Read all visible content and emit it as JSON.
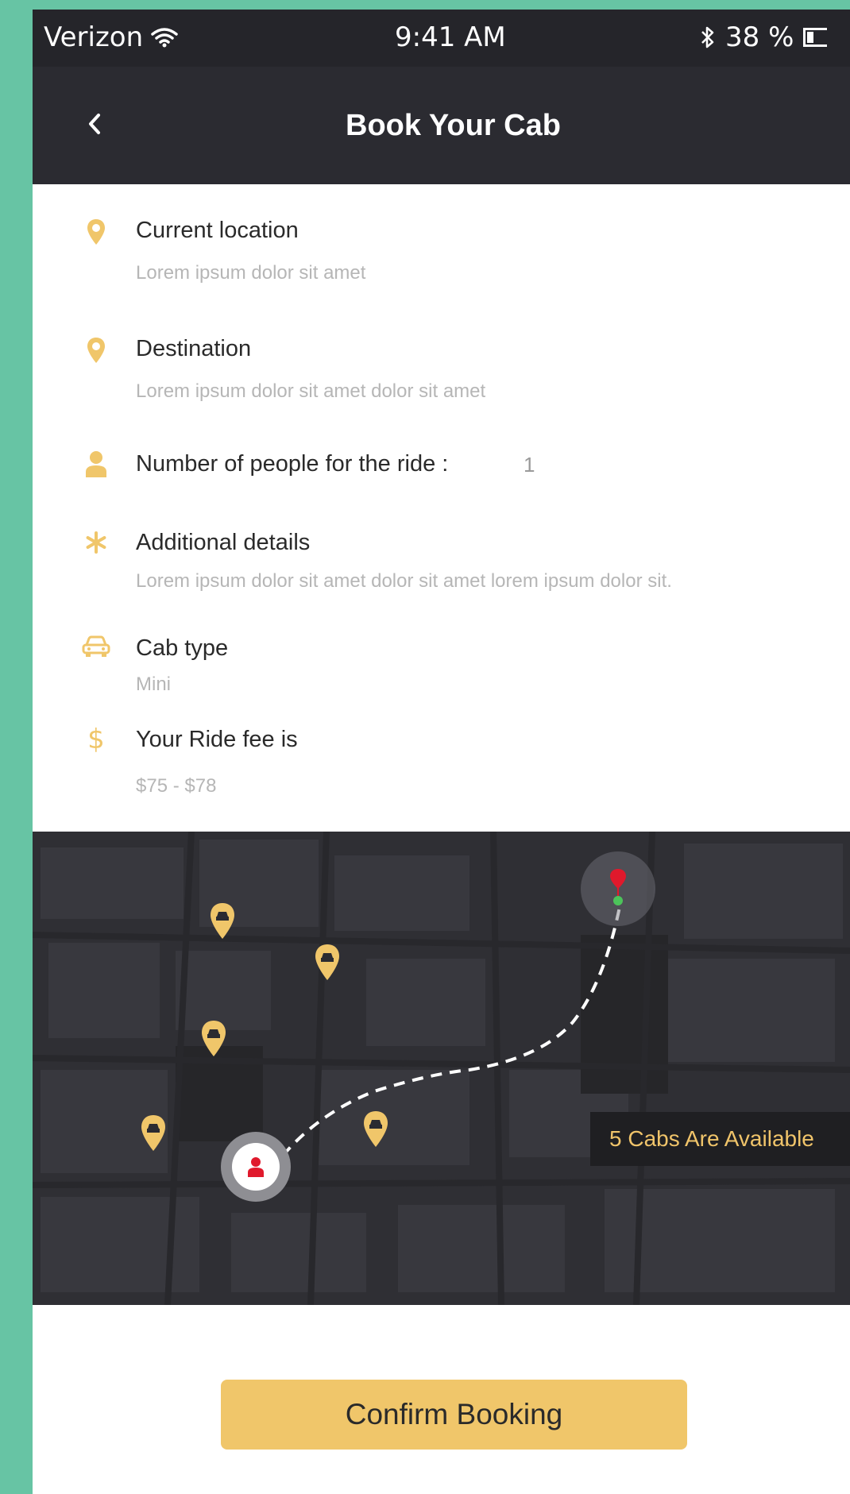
{
  "status_bar": {
    "carrier": "Verizon",
    "time": "9:41 AM",
    "battery": "38 %"
  },
  "header": {
    "title": "Book Your Cab"
  },
  "details": {
    "current_location": {
      "label": "Current location",
      "value": "Lorem ipsum dolor sit amet",
      "icon": "location-pin-icon"
    },
    "destination": {
      "label": "Destination",
      "value": "Lorem ipsum dolor sit amet dolor sit amet",
      "icon": "location-pin-icon"
    },
    "people": {
      "label": "Number of people for the ride :",
      "value": "1",
      "icon": "person-icon"
    },
    "additional": {
      "label": "Additional details",
      "value": "Lorem ipsum dolor sit amet dolor sit amet lorem ipsum dolor sit.",
      "icon": "asterisk-icon"
    },
    "cab_type": {
      "label": "Cab type",
      "value": "Mini",
      "icon": "car-icon"
    },
    "fee": {
      "label": "Your Ride fee is",
      "value": "$75 - $78",
      "icon": "dollar-icon"
    }
  },
  "map": {
    "availability": "5 Cabs Are Available"
  },
  "actions": {
    "confirm_label": "Confirm Booking"
  },
  "colors": {
    "accent": "#f0c66a",
    "header_bg": "#2b2b31",
    "map_bg": "#2f2f34",
    "frame_bg": "#67c4a4"
  }
}
